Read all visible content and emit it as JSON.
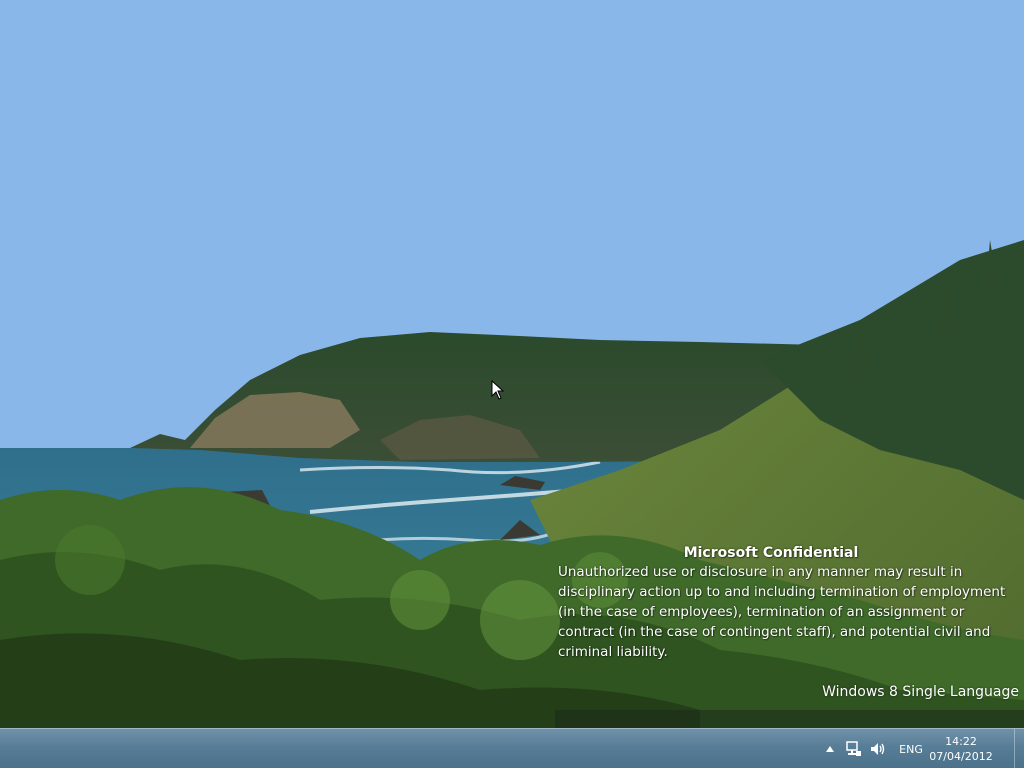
{
  "desktop": {
    "watermark": {
      "title": "Microsoft Confidential",
      "body": "Unauthorized use or disclosure in any manner may result in disciplinary action up to and including termination of employment (in the case of employees), termination of an assignment or contract (in the case of contingent staff), and potential civil and criminal liability."
    },
    "edition": "Windows 8 Single Language"
  },
  "taskbar": {
    "tray": {
      "language": "ENG",
      "time": "14:22",
      "date": "07/04/2012",
      "icons": [
        "chevron-up-icon",
        "network-icon",
        "volume-icon"
      ]
    }
  },
  "colors": {
    "sky": "#8ab7ea",
    "taskbar": "#4e7590"
  }
}
